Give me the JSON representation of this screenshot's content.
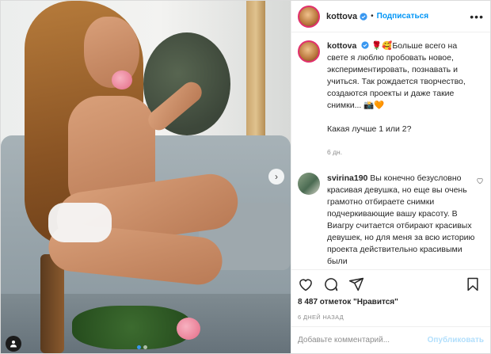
{
  "post": {
    "photo_alt": "photo",
    "carousel": {
      "slides": 2,
      "active": 1
    }
  },
  "header": {
    "username": "kottova",
    "separator": "•",
    "follow_label": "Подписаться",
    "more_label": "•••"
  },
  "caption": {
    "username": "kottova",
    "text_line1": "🌹🥰Больше всего на свете я люблю пробовать новое, экспериментировать, познавать и учиться. Так рождается творчество, создаются проекты и даже такие снимки... 📸🧡",
    "text_line2": "Какая лучше 1 или 2?",
    "time": "6 дн."
  },
  "comments": [
    {
      "username": "svirina190",
      "text": "Вы конечно безусловно красивая девушка, но еще вы очень грамотно отбираете снимки подчеркивающие вашу красоту. В Виагру считается отбирают красивых девушек, но для меня за всю историю проекта действительно красивыми были"
    }
  ],
  "likes_text": "8 487 отметок \"Нравится\"",
  "date_text": "6 ДНЕЙ НАЗАД",
  "add_comment": {
    "placeholder": "Добавьте комментарий...",
    "publish_label": "Опубликовать"
  },
  "colors": {
    "accent": "#0095f6",
    "publish_disabled": "#b2dffc",
    "muted": "#8e8e8e"
  }
}
